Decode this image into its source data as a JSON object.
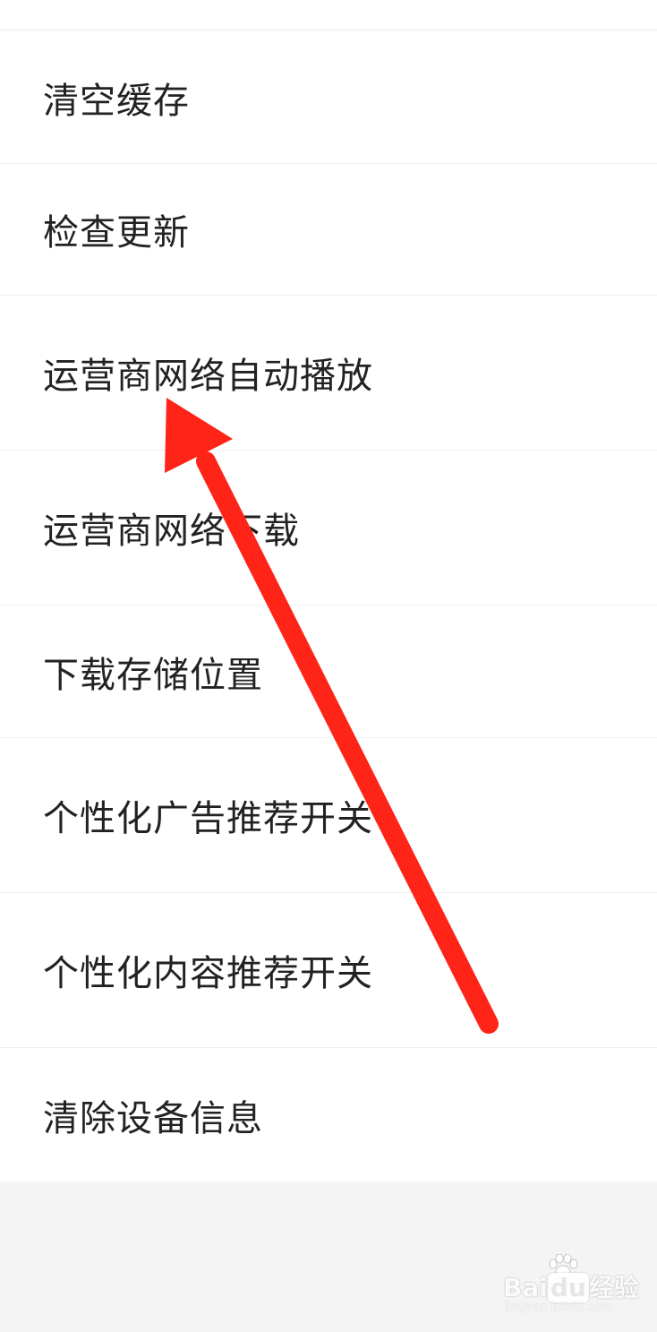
{
  "settings": {
    "items": [
      {
        "label": "清空缓存"
      },
      {
        "label": "检查更新"
      },
      {
        "label": "运营商网络自动播放"
      },
      {
        "label": "运营商网络下载"
      },
      {
        "label": "下载存储位置"
      },
      {
        "label": "个性化广告推荐开关"
      },
      {
        "label": "个性化内容推荐开关"
      },
      {
        "label": "清除设备信息"
      }
    ]
  },
  "annotation": {
    "arrow_color": "#ff2418",
    "arrow_icon": "red-arrow-icon"
  },
  "watermark": {
    "logo_prefix": "Bai",
    "logo_du": "du",
    "logo_suffix": "经验",
    "subtitle": "jingyan.baidu.com"
  }
}
